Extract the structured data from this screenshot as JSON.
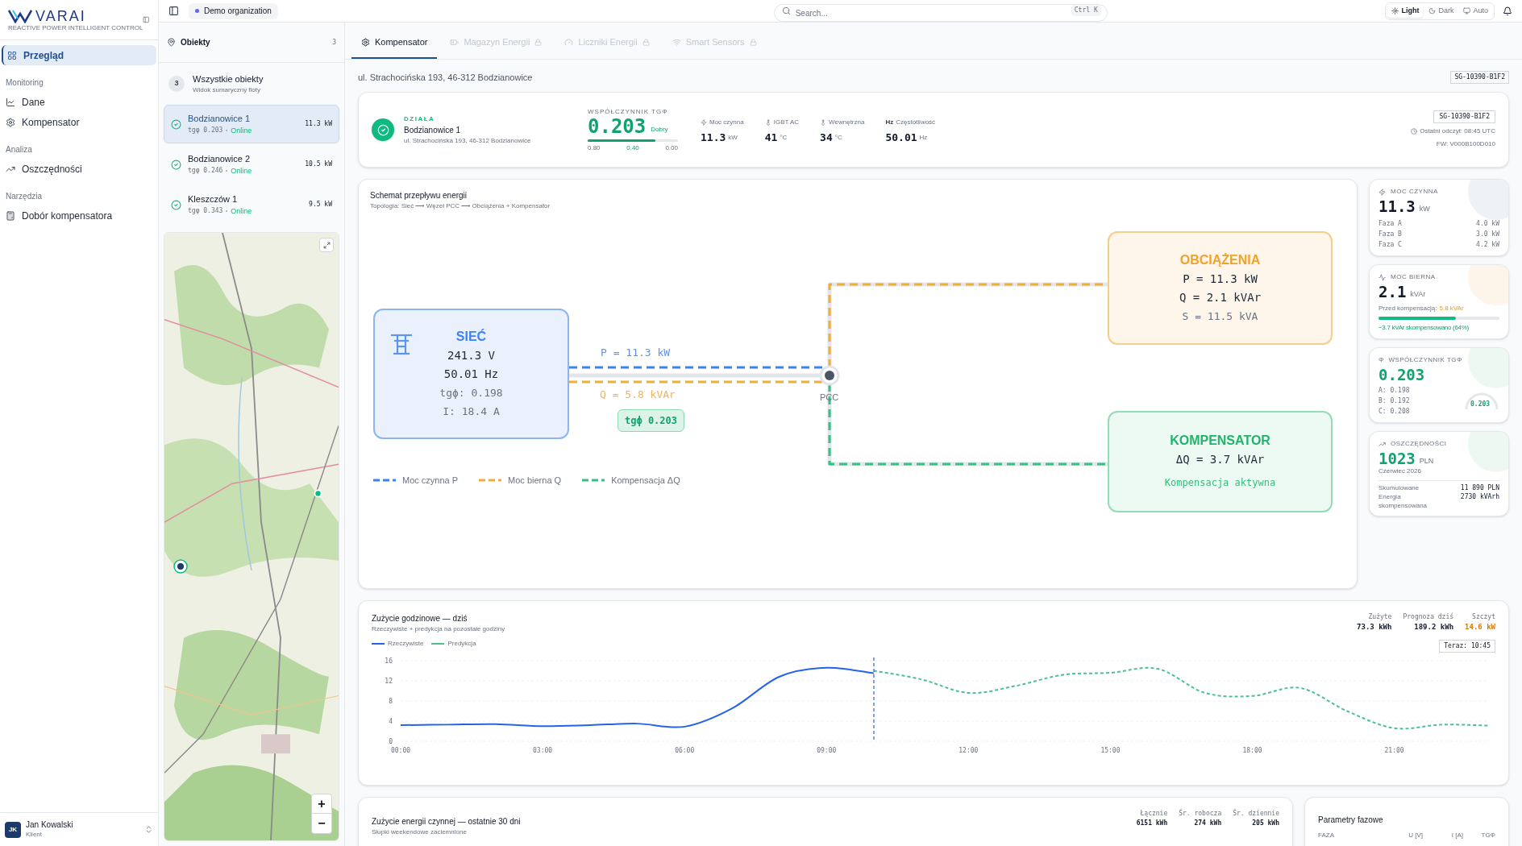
{
  "sidebar": {
    "logo": {
      "name": "VARAI",
      "tagline": "REACTIVE POWER INTELLIGENT CONTROL"
    },
    "nav": [
      {
        "kind": "link",
        "label": "Przegląd",
        "selected": true
      },
      {
        "kind": "heading",
        "label": "Monitoring"
      },
      {
        "kind": "link",
        "label": "Dane",
        "selected": false
      },
      {
        "kind": "link",
        "label": "Kompensator",
        "selected": false
      },
      {
        "kind": "heading",
        "label": "Analiza"
      },
      {
        "kind": "link",
        "label": "Oszczędności",
        "selected": false
      },
      {
        "kind": "heading",
        "label": "Narzędzia"
      },
      {
        "kind": "link",
        "label": "Dobór kompensatora",
        "selected": false
      }
    ],
    "user": {
      "initials": "JK",
      "name": "Jan Kowalski",
      "role": "Klient"
    }
  },
  "topbar": {
    "organization": "Demo organization",
    "search": {
      "placeholder": "Search...",
      "shortcut": "Ctrl K"
    },
    "theme": [
      {
        "label": "Light",
        "selected": true
      },
      {
        "label": "Dark",
        "selected": false
      },
      {
        "label": "Auto",
        "selected": false
      }
    ]
  },
  "objects": {
    "title": "Obiekty",
    "count": "3",
    "all": {
      "badge": "3",
      "title": "Wszystkie obiekty",
      "subtitle": "Widok sumaryczny floty"
    },
    "items": [
      {
        "name": "Bodzianowice 1",
        "tg": "tgφ 0.203",
        "status": "Online",
        "power": "11.3 kW",
        "selected": true
      },
      {
        "name": "Bodzianowice 2",
        "tg": "tgφ 0.246",
        "status": "Online",
        "power": "10.5 kW",
        "selected": false
      },
      {
        "name": "Kleszczów 1",
        "tg": "tgφ 0.343",
        "status": "Online",
        "power": "9.5 kW",
        "selected": false
      }
    ],
    "map": {
      "zoom_in": "+",
      "zoom_out": "−"
    }
  },
  "tabs": [
    {
      "label": "Kompensator",
      "selected": true,
      "locked": false
    },
    {
      "label": "Magazyn Energii",
      "selected": false,
      "locked": true
    },
    {
      "label": "Liczniki Energii",
      "selected": false,
      "locked": true
    },
    {
      "label": "Smart Sensors",
      "selected": false,
      "locked": true
    }
  ],
  "address": "ul. Strachocińska 193, 46-312 Bodzianowice",
  "device_badge": "SG-10390-B1F2",
  "status_card": {
    "state": "DZIAŁA",
    "name": "Bodzianowice 1",
    "address": "ul. Strachocińska 193, 46-312 Bodzianowice",
    "tg": {
      "label": "WSPÓŁCZYNNIK TGΦ",
      "value": "0.203",
      "rating": "Dobry",
      "level": 0.75,
      "scale": [
        "0.80",
        "0.40",
        "0.00"
      ]
    },
    "metrics": [
      {
        "label": "Moc czynna",
        "value": "11.3",
        "unit": "kW"
      },
      {
        "label": "IGBT AC",
        "value": "41",
        "unit": "°C"
      },
      {
        "label": "Wewnętrzna",
        "value": "34",
        "unit": "°C"
      },
      {
        "label": "Częstotliwość",
        "icon_text": "Hz",
        "value": "50.01",
        "unit": "Hz"
      }
    ],
    "device_id": "SG-10390-B1F2",
    "last_read": "Ostatni odczyt: 08:45 UTC",
    "firmware": "FW: V000B100D010"
  },
  "flow": {
    "title": "Schemat przepływu energii",
    "subtitle": "Topologia: Sieć ⟶ Węzeł PCC ⟶ Obciążenia + Kompensator",
    "grid": {
      "title": "SIEĆ",
      "lines": [
        "241.3 V",
        "50.01 Hz",
        "tgϕ: 0.198",
        "I: 18.4 A"
      ]
    },
    "load": {
      "title": "OBCIĄŻENIA",
      "lines": [
        "P = 11.3 kW",
        "Q = 2.1 kVAr",
        "S = 11.5 kVA"
      ]
    },
    "compensator": {
      "title": "KOMPENSATOR",
      "lines": [
        "ΔQ = 3.7 kVAr",
        "Kompensacja aktywna"
      ]
    },
    "pcc": "PCC",
    "p_label": "P = 11.3 kW",
    "q_label": "Q = 5.8 kVAr",
    "tg_badge": "tgϕ 0.203",
    "legend": [
      {
        "label": "Moc czynna P",
        "color": "#3b82f6"
      },
      {
        "label": "Moc bierna Q",
        "color": "#f0ad3c"
      },
      {
        "label": "Kompensacja ΔQ",
        "color": "#34c07f"
      }
    ]
  },
  "cards": [
    {
      "kind": "power",
      "title": "MOC CZYNNA",
      "value": "11.3",
      "unit": "kW",
      "rows": [
        {
          "label": "Faza A",
          "value": "4.0 kW"
        },
        {
          "label": "Faza B",
          "value": "3.0 kW"
        },
        {
          "label": "Faza C",
          "value": "4.2 kW"
        }
      ]
    },
    {
      "kind": "reactive",
      "title": "MOC BIERNA",
      "value": "2.1",
      "unit": "kVAr",
      "before_label": "Przed kompensacją:",
      "before_value": "5.8 kVAr",
      "level": 0.64,
      "note": "−3.7 kVAr skompensowano (64%)"
    },
    {
      "kind": "tg",
      "icon_text": "Φ",
      "title": "WSPÓŁCZYNNIK TGΦ",
      "value": "0.203",
      "rows": [
        {
          "label": "A: 0.198"
        },
        {
          "label": "B: 0.192"
        },
        {
          "label": "C: 0.208"
        }
      ],
      "gauge_label": "0.203"
    },
    {
      "kind": "savings",
      "title": "OSZCZĘDNOŚCI",
      "value": "1023",
      "unit": "PLN",
      "period": "Czerwiec 2026",
      "rows": [
        {
          "label": "Skumulowane",
          "value": "11 890 PLN"
        },
        {
          "label": "Energia skompensowana",
          "value": "2730 kVArh"
        }
      ]
    }
  ],
  "hourly": {
    "title": "Zużycie godzinowe — dziś",
    "subtitle": "Rzeczywiste + predykcja na pozostałe godziny",
    "stats": [
      {
        "label": "Zużyte",
        "value": "73.3 kWh",
        "color": "#111827"
      },
      {
        "label": "Prognoza dziś",
        "value": "189.2 kWh",
        "color": "#111827"
      },
      {
        "label": "Szczyt",
        "value": "14.6 kW",
        "color": "#d97706"
      }
    ],
    "now_label": "Teraz: 10:45",
    "chart_data": {
      "type": "line",
      "grid": true,
      "xlim": [
        0,
        23
      ],
      "x": [
        0,
        1,
        2,
        3,
        4,
        5,
        6,
        7,
        8,
        9,
        10,
        11,
        12,
        13,
        14,
        15,
        16,
        17,
        18,
        19,
        20,
        21,
        22,
        23
      ],
      "series": [
        {
          "name": "Rzeczywiste",
          "color": "#2563eb",
          "line_style": "solid",
          "values": [
            3.2,
            3.3,
            3.4,
            3.0,
            3.2,
            3.5,
            2.9,
            6.5,
            12.8,
            14.6,
            13.5,
            null,
            null,
            null,
            null,
            null,
            null,
            null,
            null,
            null,
            null,
            null,
            null,
            null
          ]
        },
        {
          "name": "Predykcja",
          "color": "#4fbf8f",
          "line_style": "dashed",
          "values": [
            null,
            null,
            null,
            null,
            null,
            null,
            null,
            null,
            null,
            null,
            14.0,
            12.3,
            9.6,
            11.0,
            13.2,
            13.6,
            14.4,
            9.6,
            9.0,
            10.6,
            6.0,
            2.6,
            3.3,
            3.1
          ]
        }
      ],
      "ylim": [
        0,
        16
      ],
      "yticks": [
        0,
        4,
        8,
        12,
        16
      ],
      "xticks": [
        {
          "value": 0,
          "label": "00:00"
        },
        {
          "value": 3,
          "label": "03:00"
        },
        {
          "value": 6,
          "label": "06:00"
        },
        {
          "value": 9,
          "label": "09:00"
        },
        {
          "value": 12,
          "label": "12:00"
        },
        {
          "value": 15,
          "label": "15:00"
        },
        {
          "value": 18,
          "label": "18:00"
        },
        {
          "value": 21,
          "label": "21:00"
        }
      ],
      "ref_lines": [
        {
          "axis": "x",
          "value": 10,
          "color": "#2563eb",
          "line_style": "dashed"
        }
      ]
    }
  },
  "energy30": {
    "title": "Zużycie energii czynnej — ostatnie 30 dni",
    "subtitle": "Słupki weekendowe zaciemnione",
    "stats": [
      {
        "label": "Łącznie",
        "value": "6151 kWh"
      },
      {
        "label": "Śr. robocza",
        "value": "274 kWh"
      },
      {
        "label": "Śr. dziennie",
        "value": "205 kWh"
      }
    ]
  },
  "phases": {
    "title": "Parametry fazowe",
    "columns": [
      "FAZA",
      "U [V]",
      "I [A]",
      "TGΦ"
    ]
  }
}
